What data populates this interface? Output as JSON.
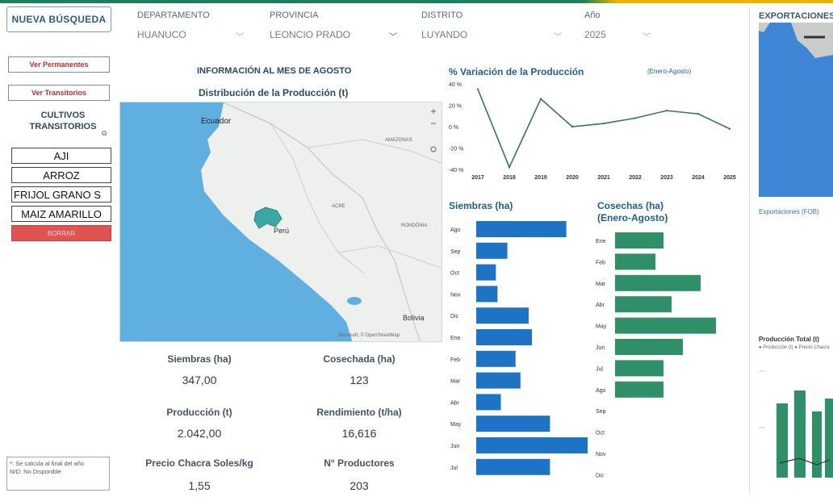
{
  "header": {
    "new_search_label": "NUEVA BÚSQUEDA",
    "filters": [
      {
        "label": "DEPARTAMENTO",
        "value": "HUANUCO"
      },
      {
        "label": "PROVINCIA",
        "value": "LEONCIO PRADO"
      },
      {
        "label": "DISTRITO",
        "value": "LUYANDO"
      },
      {
        "label": "Año",
        "value": "2025"
      }
    ]
  },
  "sidebar": {
    "btn_permanentes": "Ver Permanentes",
    "btn_transitorios": "Ver Transitorios",
    "crops_title": "CULTIVOS TRANSITORIOS",
    "crops": [
      "AJI",
      "ARROZ",
      "FRIJOL GRANO S",
      "MAIZ AMARILLO"
    ],
    "crops_reset": "BORRAR",
    "note_line1": "*: Se calcula al final del año",
    "note_line2": "N/D: No Disponible"
  },
  "main": {
    "info_title": "INFORMACIÓN AL MES DE AGOSTO",
    "map_title": "Distribución de la Producción (t)",
    "map_labels": {
      "ecuador": "Ecuador",
      "peru": "Perú",
      "bolivia": "Bolivia",
      "amazonas": "AMAZONAS",
      "acre": "ACRE",
      "rondonia": "RONDÔNIA",
      "attribution": "Microsoft, © OpenStreetMap"
    },
    "kpis": [
      {
        "label": "Siembras (ha)",
        "value": "347,00"
      },
      {
        "label": "Cosechada (ha)",
        "value": "123"
      },
      {
        "label": "Producción (t)",
        "value": "2.042,00"
      },
      {
        "label": "Rendimiento (t/ha)",
        "value": "16,616"
      },
      {
        "label": "Precio Chacra Soles/kg",
        "value": "1,55"
      },
      {
        "label": "N° Productores",
        "value": "203"
      }
    ]
  },
  "right_panel": {
    "title": "EXPORTACIONES",
    "exports_label": "Exportaciones (FOB)",
    "prod_label": "Producción Total (t)",
    "prod_legend": "● Producción (t) ● Precio Chacra"
  },
  "colors": {
    "blue": "#1f73c4",
    "green": "#2e8f68",
    "line": "#3b6f73"
  },
  "chart_data": [
    {
      "type": "line",
      "title": "% Variación de la Producción",
      "subtitle": "(Enero-Agosto)",
      "x": [
        "2017",
        "2018",
        "2019",
        "2020",
        "2021",
        "2022",
        "2023",
        "2024",
        "2025"
      ],
      "values": [
        35,
        -38,
        26,
        0,
        3,
        8,
        15,
        12,
        -2
      ],
      "yticks": [
        "40 %",
        "20 %",
        "0 %",
        "-20 %",
        "-40 %"
      ],
      "ylim": [
        -40,
        40
      ]
    },
    {
      "type": "bar",
      "orientation": "horizontal",
      "title": "Siembras (ha)",
      "categories": [
        "Ago",
        "Sep",
        "Oct",
        "Nov",
        "Dic",
        "Ene",
        "Feb",
        "Mar",
        "Abr",
        "May",
        "Jun",
        "Jul"
      ],
      "values": [
        110,
        38,
        24,
        26,
        64,
        68,
        48,
        54,
        30,
        90,
        136,
        90
      ]
    },
    {
      "type": "bar",
      "orientation": "horizontal",
      "title": "Cosechas (ha) (Enero-Agosto)",
      "categories": [
        "Ene",
        "Feb",
        "Mar",
        "Abr",
        "May",
        "Jun",
        "Jul",
        "Ago",
        "Sep",
        "Oct",
        "Nov",
        "Dic"
      ],
      "values": [
        60,
        50,
        106,
        70,
        125,
        84,
        60,
        60,
        0,
        0,
        0,
        0
      ]
    }
  ]
}
